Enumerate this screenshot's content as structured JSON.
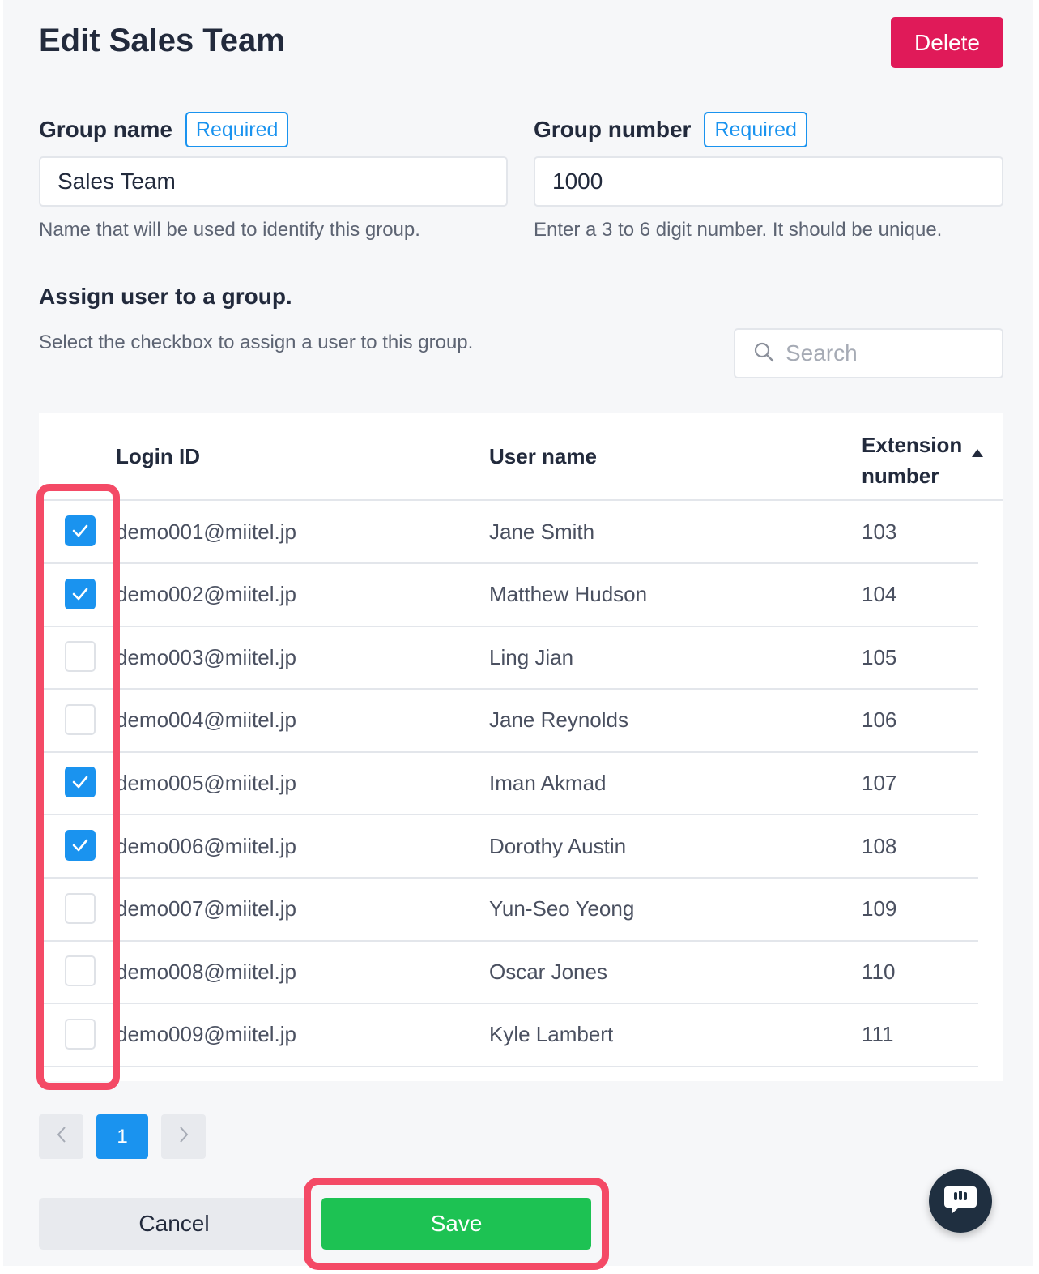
{
  "header": {
    "title": "Edit Sales Team",
    "delete_label": "Delete"
  },
  "form": {
    "group_name": {
      "label": "Group name",
      "badge": "Required",
      "value": "Sales Team",
      "hint": "Name that will be used to identify this group."
    },
    "group_number": {
      "label": "Group number",
      "badge": "Required",
      "value": "1000",
      "hint": "Enter a 3 to 6 digit number. It should be unique."
    }
  },
  "assign": {
    "title": "Assign user to a group.",
    "description": "Select the checkbox to assign a user to this group.",
    "search_placeholder": "Search"
  },
  "table": {
    "columns": {
      "login_id": "Login ID",
      "user_name": "User name",
      "extension_line1": "Extension",
      "extension_line2": "number"
    },
    "sort": "extension-ascending",
    "rows": [
      {
        "checked": true,
        "login": "demo001@miitel.jp",
        "name": "Jane Smith",
        "ext": "103"
      },
      {
        "checked": true,
        "login": "demo002@miitel.jp",
        "name": "Matthew Hudson",
        "ext": "104"
      },
      {
        "checked": false,
        "login": "demo003@miitel.jp",
        "name": "Ling Jian",
        "ext": "105"
      },
      {
        "checked": false,
        "login": "demo004@miitel.jp",
        "name": "Jane Reynolds",
        "ext": "106"
      },
      {
        "checked": true,
        "login": "demo005@miitel.jp",
        "name": "Iman Akmad",
        "ext": "107"
      },
      {
        "checked": true,
        "login": "demo006@miitel.jp",
        "name": "Dorothy Austin",
        "ext": "108"
      },
      {
        "checked": false,
        "login": "demo007@miitel.jp",
        "name": "Yun-Seo Yeong",
        "ext": "109"
      },
      {
        "checked": false,
        "login": "demo008@miitel.jp",
        "name": "Oscar Jones",
        "ext": "110"
      },
      {
        "checked": false,
        "login": "demo009@miitel.jp",
        "name": "Kyle Lambert",
        "ext": "111"
      }
    ]
  },
  "pagination": {
    "current_page": "1"
  },
  "footer": {
    "cancel_label": "Cancel",
    "save_label": "Save"
  },
  "colors": {
    "accent": "#1a93ef",
    "danger": "#e01a59",
    "success": "#1dc253",
    "highlight": "#f44a66"
  },
  "icons": {
    "search": "search-icon",
    "sort": "sort-ascending-icon",
    "checkmark": "check-icon",
    "prev": "chevron-left-icon",
    "next": "chevron-right-icon",
    "chat": "chat-icon"
  }
}
